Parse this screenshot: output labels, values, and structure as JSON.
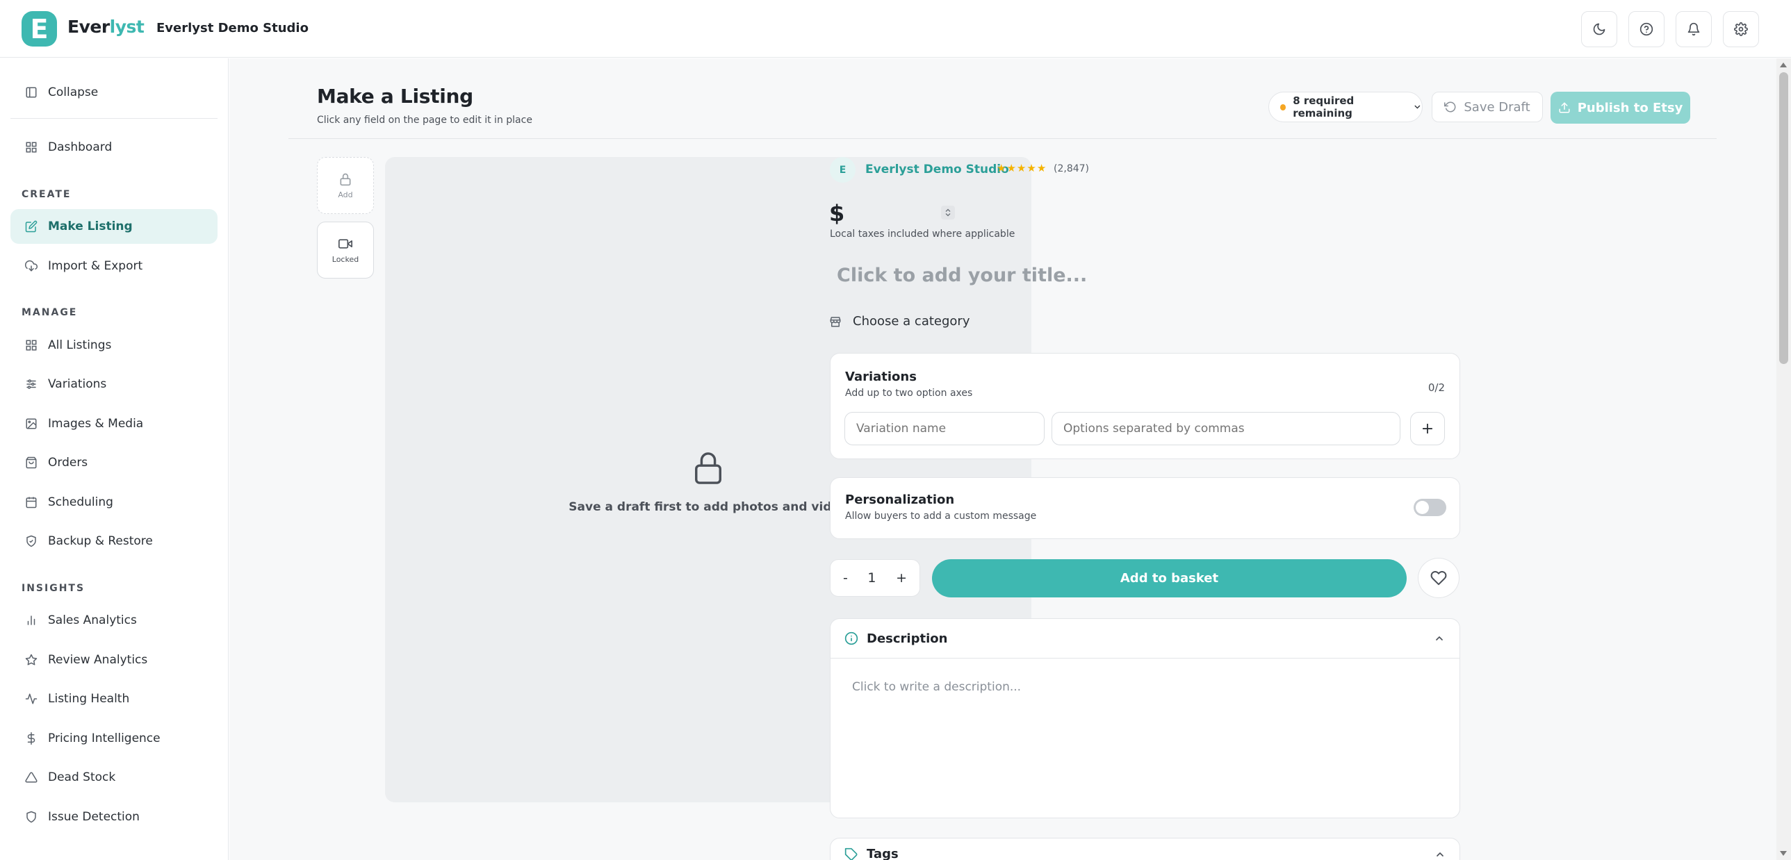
{
  "app": {
    "logo_letter": "E",
    "logo_word_main": "Ever",
    "logo_word_accent": "lyst",
    "studio_name": "Everlyst Demo Studio",
    "accent_color": "#3eb8b1"
  },
  "topbar": {
    "icons": [
      "moon-icon",
      "help-icon",
      "bell-icon",
      "settings-icon"
    ]
  },
  "sidebar": {
    "collapse_label": "Collapse",
    "dashboard_label": "Dashboard",
    "sections": {
      "create": "CREATE",
      "manage": "MANAGE",
      "insights": "INSIGHTS"
    },
    "items": {
      "make_listing": "Make Listing",
      "import_export": "Import & Export",
      "all_listings": "All Listings",
      "variations": "Variations",
      "images_media": "Images & Media",
      "orders": "Orders",
      "scheduling": "Scheduling",
      "backup_restore": "Backup & Restore",
      "sales_analytics": "Sales Analytics",
      "review_analytics": "Review Analytics",
      "listing_health": "Listing Health",
      "pricing_intelligence": "Pricing Intelligence",
      "dead_stock": "Dead Stock",
      "issue_detection": "Issue Detection"
    },
    "active_item": "Make Listing"
  },
  "header": {
    "title": "Make a Listing",
    "subtitle": "Click any field on the page to edit it in place",
    "required_remaining": "8 required remaining",
    "save_draft_label": "Save Draft",
    "publish_label": "Publish to Etsy"
  },
  "media": {
    "thumb_add_label": "Add",
    "thumb_locked_label": "Locked",
    "locked_message": "Save a draft first to add photos and video"
  },
  "listing": {
    "shop_initial": "E",
    "shop_name": "Everlyst Demo Studio",
    "rating_stars": 5,
    "review_count": "(2,847)",
    "currency_symbol": "$",
    "tax_note": "Local taxes included where applicable",
    "title_placeholder": "Click to add your title...",
    "category_label": "Choose a category"
  },
  "variations": {
    "title": "Variations",
    "subtitle": "Add up to two option axes",
    "count": "0/2",
    "name_placeholder": "Variation name",
    "options_placeholder": "Options separated by commas",
    "add_label": "+"
  },
  "personalization": {
    "title": "Personalization",
    "subtitle": "Allow buyers to add a custom message",
    "enabled": false
  },
  "purchase": {
    "minus_label": "-",
    "quantity": "1",
    "plus_label": "+",
    "basket_label": "Add to basket"
  },
  "description": {
    "title": "Description",
    "placeholder": "Click to write a description..."
  },
  "tags": {
    "title": "Tags"
  }
}
